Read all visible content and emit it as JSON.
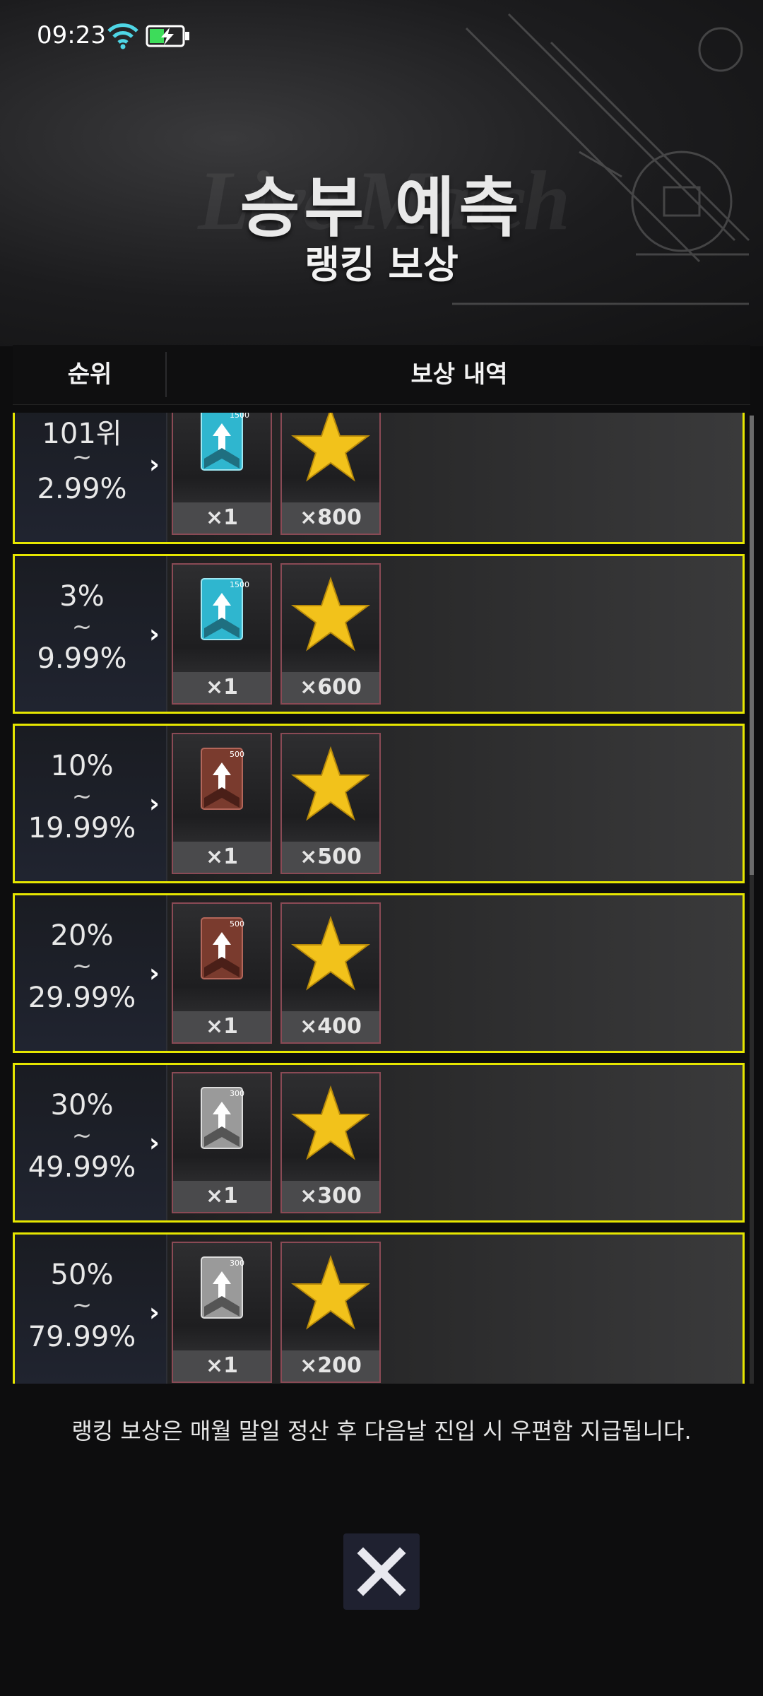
{
  "status_bar": {
    "time": "09:23"
  },
  "header": {
    "title": "승부 예측",
    "subtitle": "랭킹 보상",
    "background_text": "Live Match"
  },
  "table": {
    "col_rank": "순위",
    "col_reward": "보상 내역",
    "rows": [
      {
        "rank_from": "101위",
        "tilde": "~",
        "rank_to": "2.99%",
        "card_tier": "1500",
        "card_qty": "×1",
        "star_qty": "×800"
      },
      {
        "rank_from": "3%",
        "tilde": "~",
        "rank_to": "9.99%",
        "card_tier": "1500",
        "card_qty": "×1",
        "star_qty": "×600"
      },
      {
        "rank_from": "10%",
        "tilde": "~",
        "rank_to": "19.99%",
        "card_tier": "500",
        "card_qty": "×1",
        "star_qty": "×500"
      },
      {
        "rank_from": "20%",
        "tilde": "~",
        "rank_to": "29.99%",
        "card_tier": "500",
        "card_qty": "×1",
        "star_qty": "×400"
      },
      {
        "rank_from": "30%",
        "tilde": "~",
        "rank_to": "49.99%",
        "card_tier": "300",
        "card_qty": "×1",
        "star_qty": "×300"
      },
      {
        "rank_from": "50%",
        "tilde": "~",
        "rank_to": "79.99%",
        "card_tier": "300",
        "card_qty": "×1",
        "star_qty": "×200"
      }
    ]
  },
  "footer": {
    "note": "랭킹 보상은 매월 말일 정산 후 다음날 진입 시 우편함 지급됩니다."
  },
  "icons": {
    "close": "close-icon",
    "wifi": "wifi-icon",
    "battery": "battery-charging-icon"
  },
  "colors": {
    "row_border": "#e6e600",
    "card_tier_1500": "#2fb6cf",
    "card_tier_500": "#7a3b2e",
    "card_tier_300": "#9a9a9a",
    "star": "#f2c21b"
  }
}
